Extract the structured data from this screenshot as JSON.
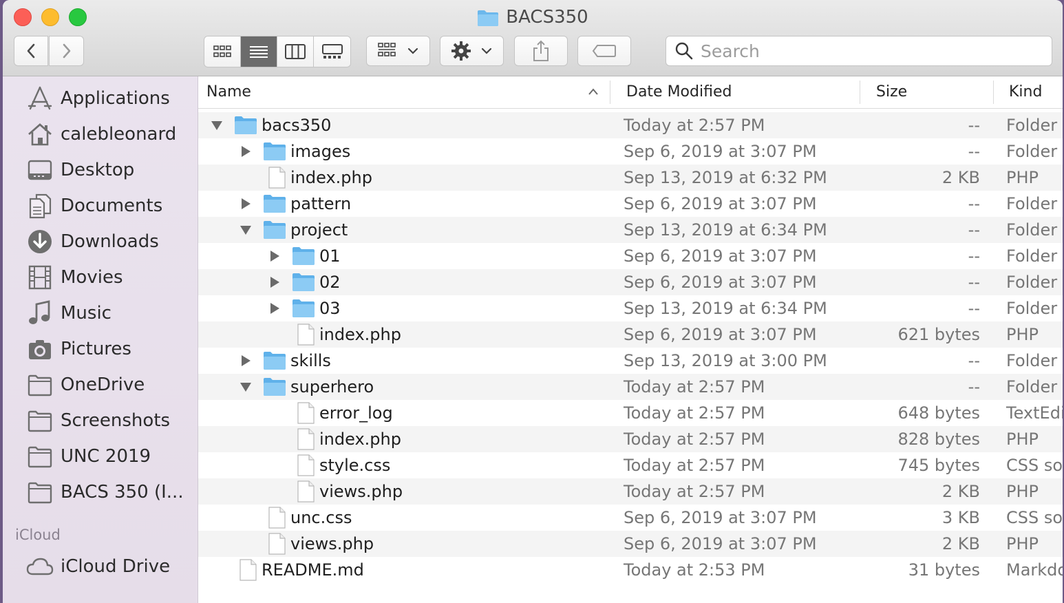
{
  "window": {
    "title": "BACS350"
  },
  "toolbar": {
    "back_icon": "chevron-left-icon",
    "forward_icon": "chevron-right-icon",
    "view_modes": [
      "icon-view",
      "list-view",
      "column-view",
      "gallery-view"
    ],
    "active_view": "list-view",
    "search_placeholder": "Search"
  },
  "sidebar": {
    "favorites": [
      {
        "label": "Applications",
        "icon": "applications-icon"
      },
      {
        "label": "calebleonard",
        "icon": "home-icon"
      },
      {
        "label": "Desktop",
        "icon": "desktop-icon"
      },
      {
        "label": "Documents",
        "icon": "documents-icon"
      },
      {
        "label": "Downloads",
        "icon": "downloads-icon"
      },
      {
        "label": "Movies",
        "icon": "movies-icon"
      },
      {
        "label": "Music",
        "icon": "music-icon"
      },
      {
        "label": "Pictures",
        "icon": "pictures-icon"
      },
      {
        "label": "OneDrive",
        "icon": "folder-icon"
      },
      {
        "label": "Screenshots",
        "icon": "folder-icon"
      },
      {
        "label": "UNC 2019",
        "icon": "folder-icon"
      },
      {
        "label": "BACS 350 (I...",
        "icon": "folder-icon"
      }
    ],
    "icloud_heading": "iCloud",
    "icloud": [
      {
        "label": "iCloud Drive",
        "icon": "cloud-icon"
      }
    ]
  },
  "columns": {
    "name": "Name",
    "date": "Date Modified",
    "size": "Size",
    "kind": "Kind"
  },
  "files": [
    {
      "name": "bacs350",
      "date": "Today at 2:57 PM",
      "size": "--",
      "kind": "Folder"
    },
    {
      "name": "images",
      "date": "Sep 6, 2019 at 3:07 PM",
      "size": "--",
      "kind": "Folder"
    },
    {
      "name": "index.php",
      "date": "Sep 13, 2019 at 6:32 PM",
      "size": "2 KB",
      "kind": "PHP"
    },
    {
      "name": "pattern",
      "date": "Sep 6, 2019 at 3:07 PM",
      "size": "--",
      "kind": "Folder"
    },
    {
      "name": "project",
      "date": "Sep 13, 2019 at 6:34 PM",
      "size": "--",
      "kind": "Folder"
    },
    {
      "name": "01",
      "date": "Sep 6, 2019 at 3:07 PM",
      "size": "--",
      "kind": "Folder"
    },
    {
      "name": "02",
      "date": "Sep 6, 2019 at 3:07 PM",
      "size": "--",
      "kind": "Folder"
    },
    {
      "name": "03",
      "date": "Sep 13, 2019 at 6:34 PM",
      "size": "--",
      "kind": "Folder"
    },
    {
      "name": "index.php",
      "date": "Sep 6, 2019 at 3:07 PM",
      "size": "621 bytes",
      "kind": "PHP"
    },
    {
      "name": "skills",
      "date": "Sep 13, 2019 at 3:00 PM",
      "size": "--",
      "kind": "Folder"
    },
    {
      "name": "superhero",
      "date": "Today at 2:57 PM",
      "size": "--",
      "kind": "Folder"
    },
    {
      "name": "error_log",
      "date": "Today at 2:57 PM",
      "size": "648 bytes",
      "kind": "TextEdi"
    },
    {
      "name": "index.php",
      "date": "Today at 2:57 PM",
      "size": "828 bytes",
      "kind": "PHP"
    },
    {
      "name": "style.css",
      "date": "Today at 2:57 PM",
      "size": "745 bytes",
      "kind": "CSS so"
    },
    {
      "name": "views.php",
      "date": "Today at 2:57 PM",
      "size": "2 KB",
      "kind": "PHP"
    },
    {
      "name": "unc.css",
      "date": "Sep 6, 2019 at 3:07 PM",
      "size": "3 KB",
      "kind": "CSS so"
    },
    {
      "name": "views.php",
      "date": "Sep 6, 2019 at 3:07 PM",
      "size": "2 KB",
      "kind": "PHP"
    },
    {
      "name": "README.md",
      "date": "Today at 2:53 PM",
      "size": "31 bytes",
      "kind": "Markdo"
    }
  ]
}
